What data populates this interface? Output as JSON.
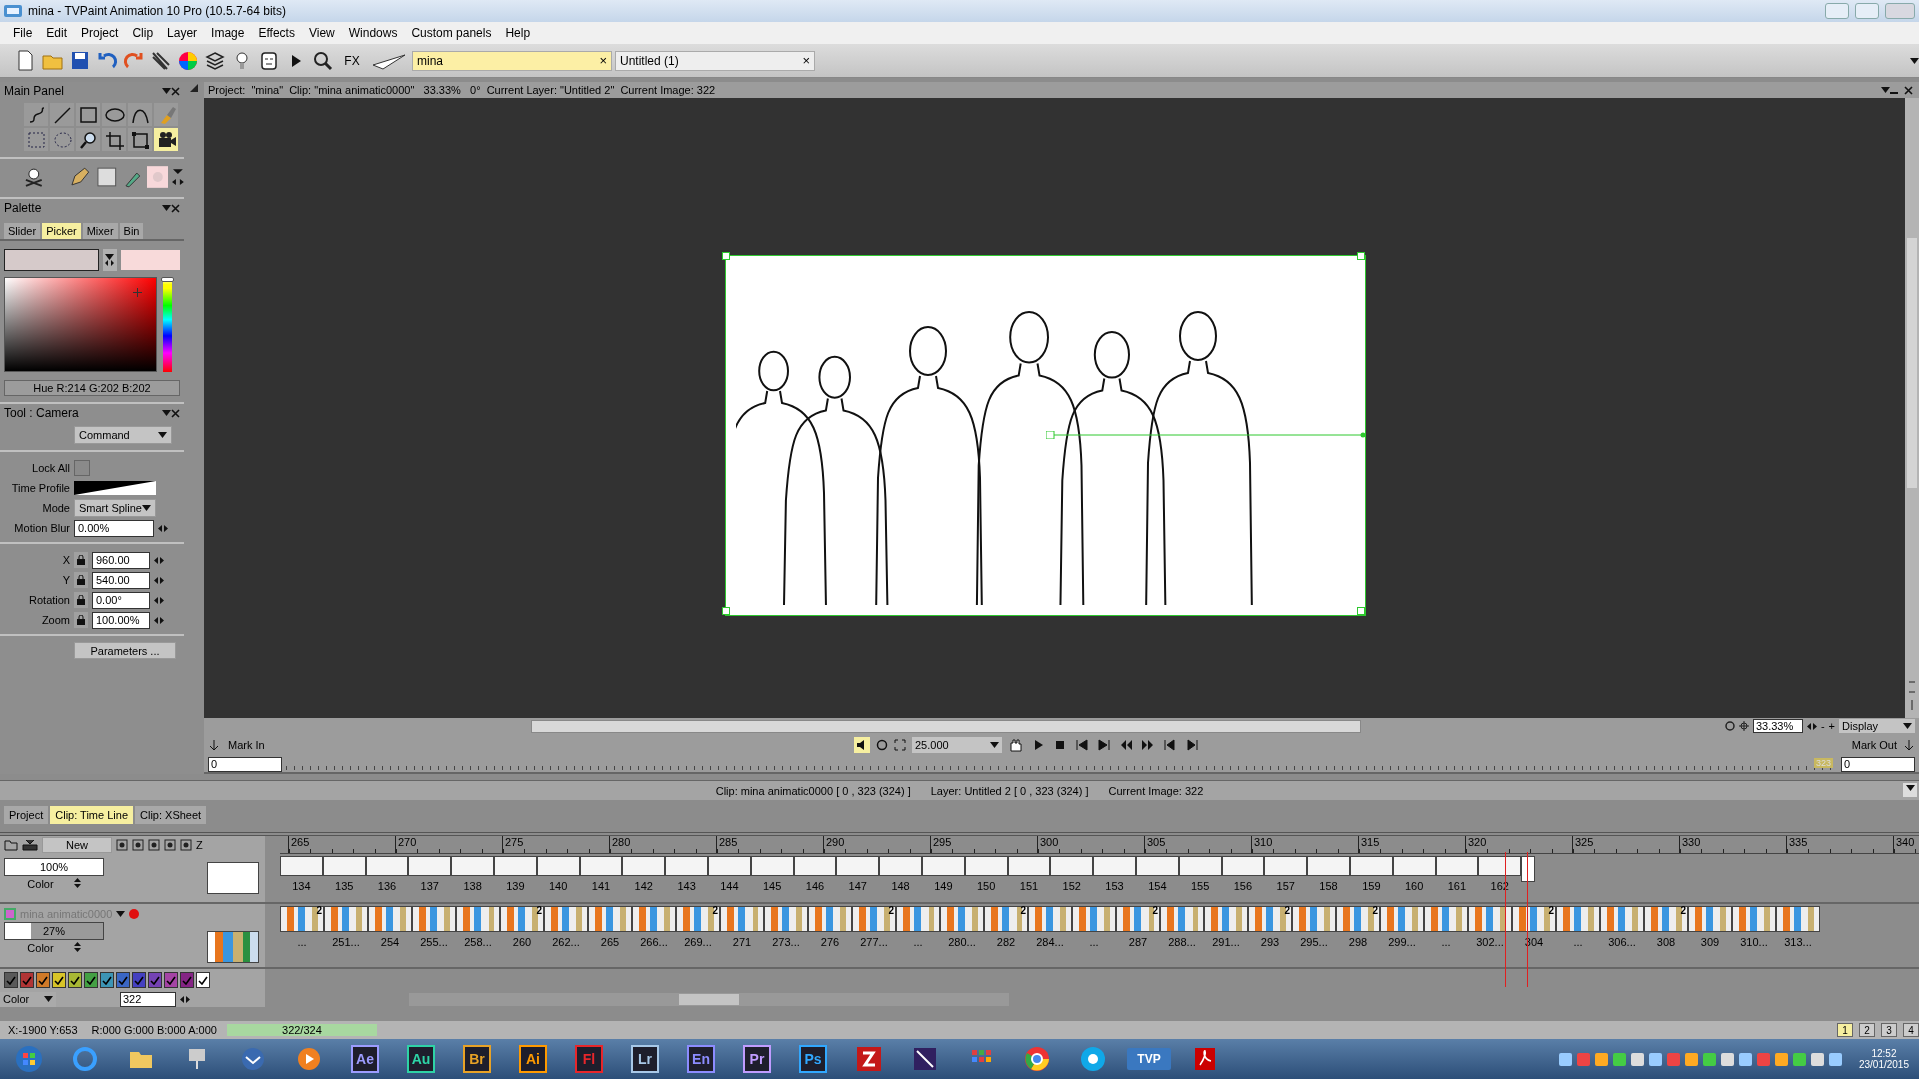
{
  "window": {
    "title": "mina - TVPaint Animation 10 Pro (10.5.7-64 bits)"
  },
  "menu": [
    "File",
    "Edit",
    "Project",
    "Clip",
    "Layer",
    "Image",
    "Effects",
    "View",
    "Windows",
    "Custom panels",
    "Help"
  ],
  "toolbar": {
    "fx_label": "FX",
    "documents": [
      {
        "label": "mina",
        "selected": true,
        "close": "×"
      },
      {
        "label": "Untitled (1)",
        "selected": false,
        "close": "×"
      }
    ]
  },
  "main_panel": {
    "title": "Main Panel",
    "tools": [
      {
        "kind": "curve",
        "selected": false
      },
      {
        "kind": "line",
        "selected": false
      },
      {
        "kind": "rect",
        "selected": false
      },
      {
        "kind": "ellipse",
        "selected": false
      },
      {
        "kind": "bezier",
        "selected": false
      },
      {
        "kind": "fill",
        "selected": false
      },
      {
        "kind": "select",
        "selected": false
      },
      {
        "kind": "lasso",
        "selected": false
      },
      {
        "kind": "zoom",
        "selected": false
      },
      {
        "kind": "crop",
        "selected": false
      },
      {
        "kind": "transform",
        "selected": false
      },
      {
        "kind": "camera",
        "selected": true
      }
    ]
  },
  "palette": {
    "title": "Palette",
    "tabs": [
      {
        "label": "Slider",
        "selected": false
      },
      {
        "label": "Picker",
        "selected": true
      },
      {
        "label": "Mixer",
        "selected": false
      },
      {
        "label": "Bin",
        "selected": false
      }
    ],
    "colors": [
      {
        "color": "#d6caca"
      },
      {
        "color": "#f8dada"
      }
    ],
    "hue_slider": {
      "level": 0
    },
    "readout": "Hue R:214 G:202 B:202"
  },
  "tool_panel": {
    "title": "Tool : Camera",
    "command": "Command",
    "options": [
      {
        "kind": "checkbox",
        "label": "Lock All",
        "checked": false
      },
      {
        "kind": "profile",
        "label": "Time Profile"
      },
      {
        "kind": "select",
        "label": "Mode",
        "value": "Smart Spline"
      },
      {
        "kind": "input",
        "label": "Motion Blur",
        "value": "0.00%"
      }
    ],
    "coords": [
      {
        "label": "X",
        "value": "960.00"
      },
      {
        "label": "Y",
        "value": "540.00"
      },
      {
        "label": "Rotation",
        "value": "0.00°"
      },
      {
        "label": "Zoom",
        "value": "100.00%"
      }
    ],
    "button": "Parameters ..."
  },
  "viewport": {
    "info": "Project:  \"mina\"  Clip: \"mina animatic0000\"   33.33%   0°  Current Layer: \"Untitled 2\"  Current Image: 322",
    "zoom": "33.33%",
    "zoom_minus": "-",
    "zoom_plus": "+",
    "display": "Display",
    "mark_in": "Mark In",
    "mark_out": "Mark Out",
    "fps": "25.000",
    "in_value": "0",
    "out_value": "0",
    "end_frame": "323"
  },
  "clip_info": {
    "clip": "Clip: mina animatic0000 [ 0 , 323  (324) ]",
    "layer": "Layer: Untitled 2 [ 0 , 323  (324) ]",
    "image": "Current Image: 322"
  },
  "bottom_tabs": [
    {
      "label": "Project",
      "selected": false
    },
    {
      "label": "Clip: Time Line",
      "selected": true
    },
    {
      "label": "Clip: XSheet",
      "selected": false
    }
  ],
  "timeline": {
    "new_button": "New",
    "z_label": "Z",
    "ruler": [
      "265",
      "270",
      "275",
      "280",
      "285",
      "290",
      "295",
      "300",
      "305",
      "310",
      "315",
      "320",
      "325",
      "330",
      "335",
      "340"
    ],
    "layers": [
      {
        "kind": "sketch",
        "opacity": "100%",
        "level": 1,
        "blend": "Color",
        "frames": [
          {
            "label": "134"
          },
          {
            "label": "135"
          },
          {
            "label": "136"
          },
          {
            "label": "137"
          },
          {
            "label": "138"
          },
          {
            "label": "139"
          },
          {
            "label": "140"
          },
          {
            "label": "141"
          },
          {
            "label": "142"
          },
          {
            "label": "143"
          },
          {
            "label": "144"
          },
          {
            "label": "145"
          },
          {
            "label": "146"
          },
          {
            "label": "147"
          },
          {
            "label": "148"
          },
          {
            "label": "149"
          },
          {
            "label": "150"
          },
          {
            "label": "151"
          },
          {
            "label": "152"
          },
          {
            "label": "153"
          },
          {
            "label": "154"
          },
          {
            "label": "155"
          },
          {
            "label": "156"
          },
          {
            "label": "157"
          },
          {
            "label": "158"
          },
          {
            "label": "159"
          },
          {
            "label": "160"
          },
          {
            "label": "161"
          },
          {
            "label": "162"
          }
        ]
      },
      {
        "kind": "color",
        "name": "mina animatic0000",
        "opacity": "27%",
        "level": 0.27,
        "blend": "Color",
        "frames": [
          {
            "label": "...",
            "hold": "2"
          },
          {
            "label": "251..."
          },
          {
            "label": "254"
          },
          {
            "label": "255..."
          },
          {
            "label": "258..."
          },
          {
            "label": "260",
            "hold": "2"
          },
          {
            "label": "262..."
          },
          {
            "label": "265"
          },
          {
            "label": "266..."
          },
          {
            "label": "269...",
            "hold": "2"
          },
          {
            "label": "271"
          },
          {
            "label": "273..."
          },
          {
            "label": "276"
          },
          {
            "label": "277...",
            "hold": "2"
          },
          {
            "label": "..."
          },
          {
            "label": "280..."
          },
          {
            "label": "282",
            "hold": "2"
          },
          {
            "label": "284..."
          },
          {
            "label": "..."
          },
          {
            "label": "287",
            "hold": "2"
          },
          {
            "label": "288..."
          },
          {
            "label": "291..."
          },
          {
            "label": "293",
            "hold": "2"
          },
          {
            "label": "295..."
          },
          {
            "label": "298",
            "hold": "2"
          },
          {
            "label": "299..."
          },
          {
            "label": "..."
          },
          {
            "label": "302..."
          },
          {
            "label": "304",
            "hold": "2"
          },
          {
            "label": "..."
          },
          {
            "label": "306..."
          },
          {
            "label": "308",
            "hold": "2"
          },
          {
            "label": "309"
          },
          {
            "label": "310..."
          },
          {
            "label": "313..."
          }
        ]
      }
    ],
    "swatches": [
      {
        "color": "#5a5a5a"
      },
      {
        "color": "#b03434"
      },
      {
        "color": "#d07a28"
      },
      {
        "color": "#d8c428"
      },
      {
        "color": "#a8b834"
      },
      {
        "color": "#44a044"
      },
      {
        "color": "#3c94b4"
      },
      {
        "color": "#3a66c4"
      },
      {
        "color": "#4440c0"
      },
      {
        "color": "#7442b4"
      },
      {
        "color": "#a444a4"
      },
      {
        "color": "#842484"
      },
      {
        "color": "#ffffff"
      }
    ],
    "color_select": "Color",
    "current_frame": "322"
  },
  "status_bar": {
    "coords": "X:-1900  Y:653",
    "rgba": "R:000 G:000 B:000 A:000",
    "progress": "322/324",
    "pages": [
      {
        "label": "1",
        "selected": true
      },
      {
        "label": "2",
        "selected": false
      },
      {
        "label": "3",
        "selected": false
      },
      {
        "label": "4",
        "selected": false
      }
    ]
  },
  "taskbar": {
    "apps": [
      {
        "label": "Ae",
        "color": "#9c9cff"
      },
      {
        "label": "Au",
        "color": "#2ed3a6"
      },
      {
        "label": "Br",
        "color": "#e8a226"
      },
      {
        "label": "Ai",
        "color": "#ff9a00"
      },
      {
        "label": "Fl",
        "color": "#e8262b"
      },
      {
        "label": "Lr",
        "color": "#a8c8e8"
      },
      {
        "label": "En",
        "color": "#8c8cff"
      },
      {
        "label": "Pr",
        "color": "#c09cff"
      },
      {
        "label": "Ps",
        "color": "#31a8ff"
      }
    ],
    "tvp": "TVP",
    "time": "12:52",
    "date": "23/01/2015"
  }
}
